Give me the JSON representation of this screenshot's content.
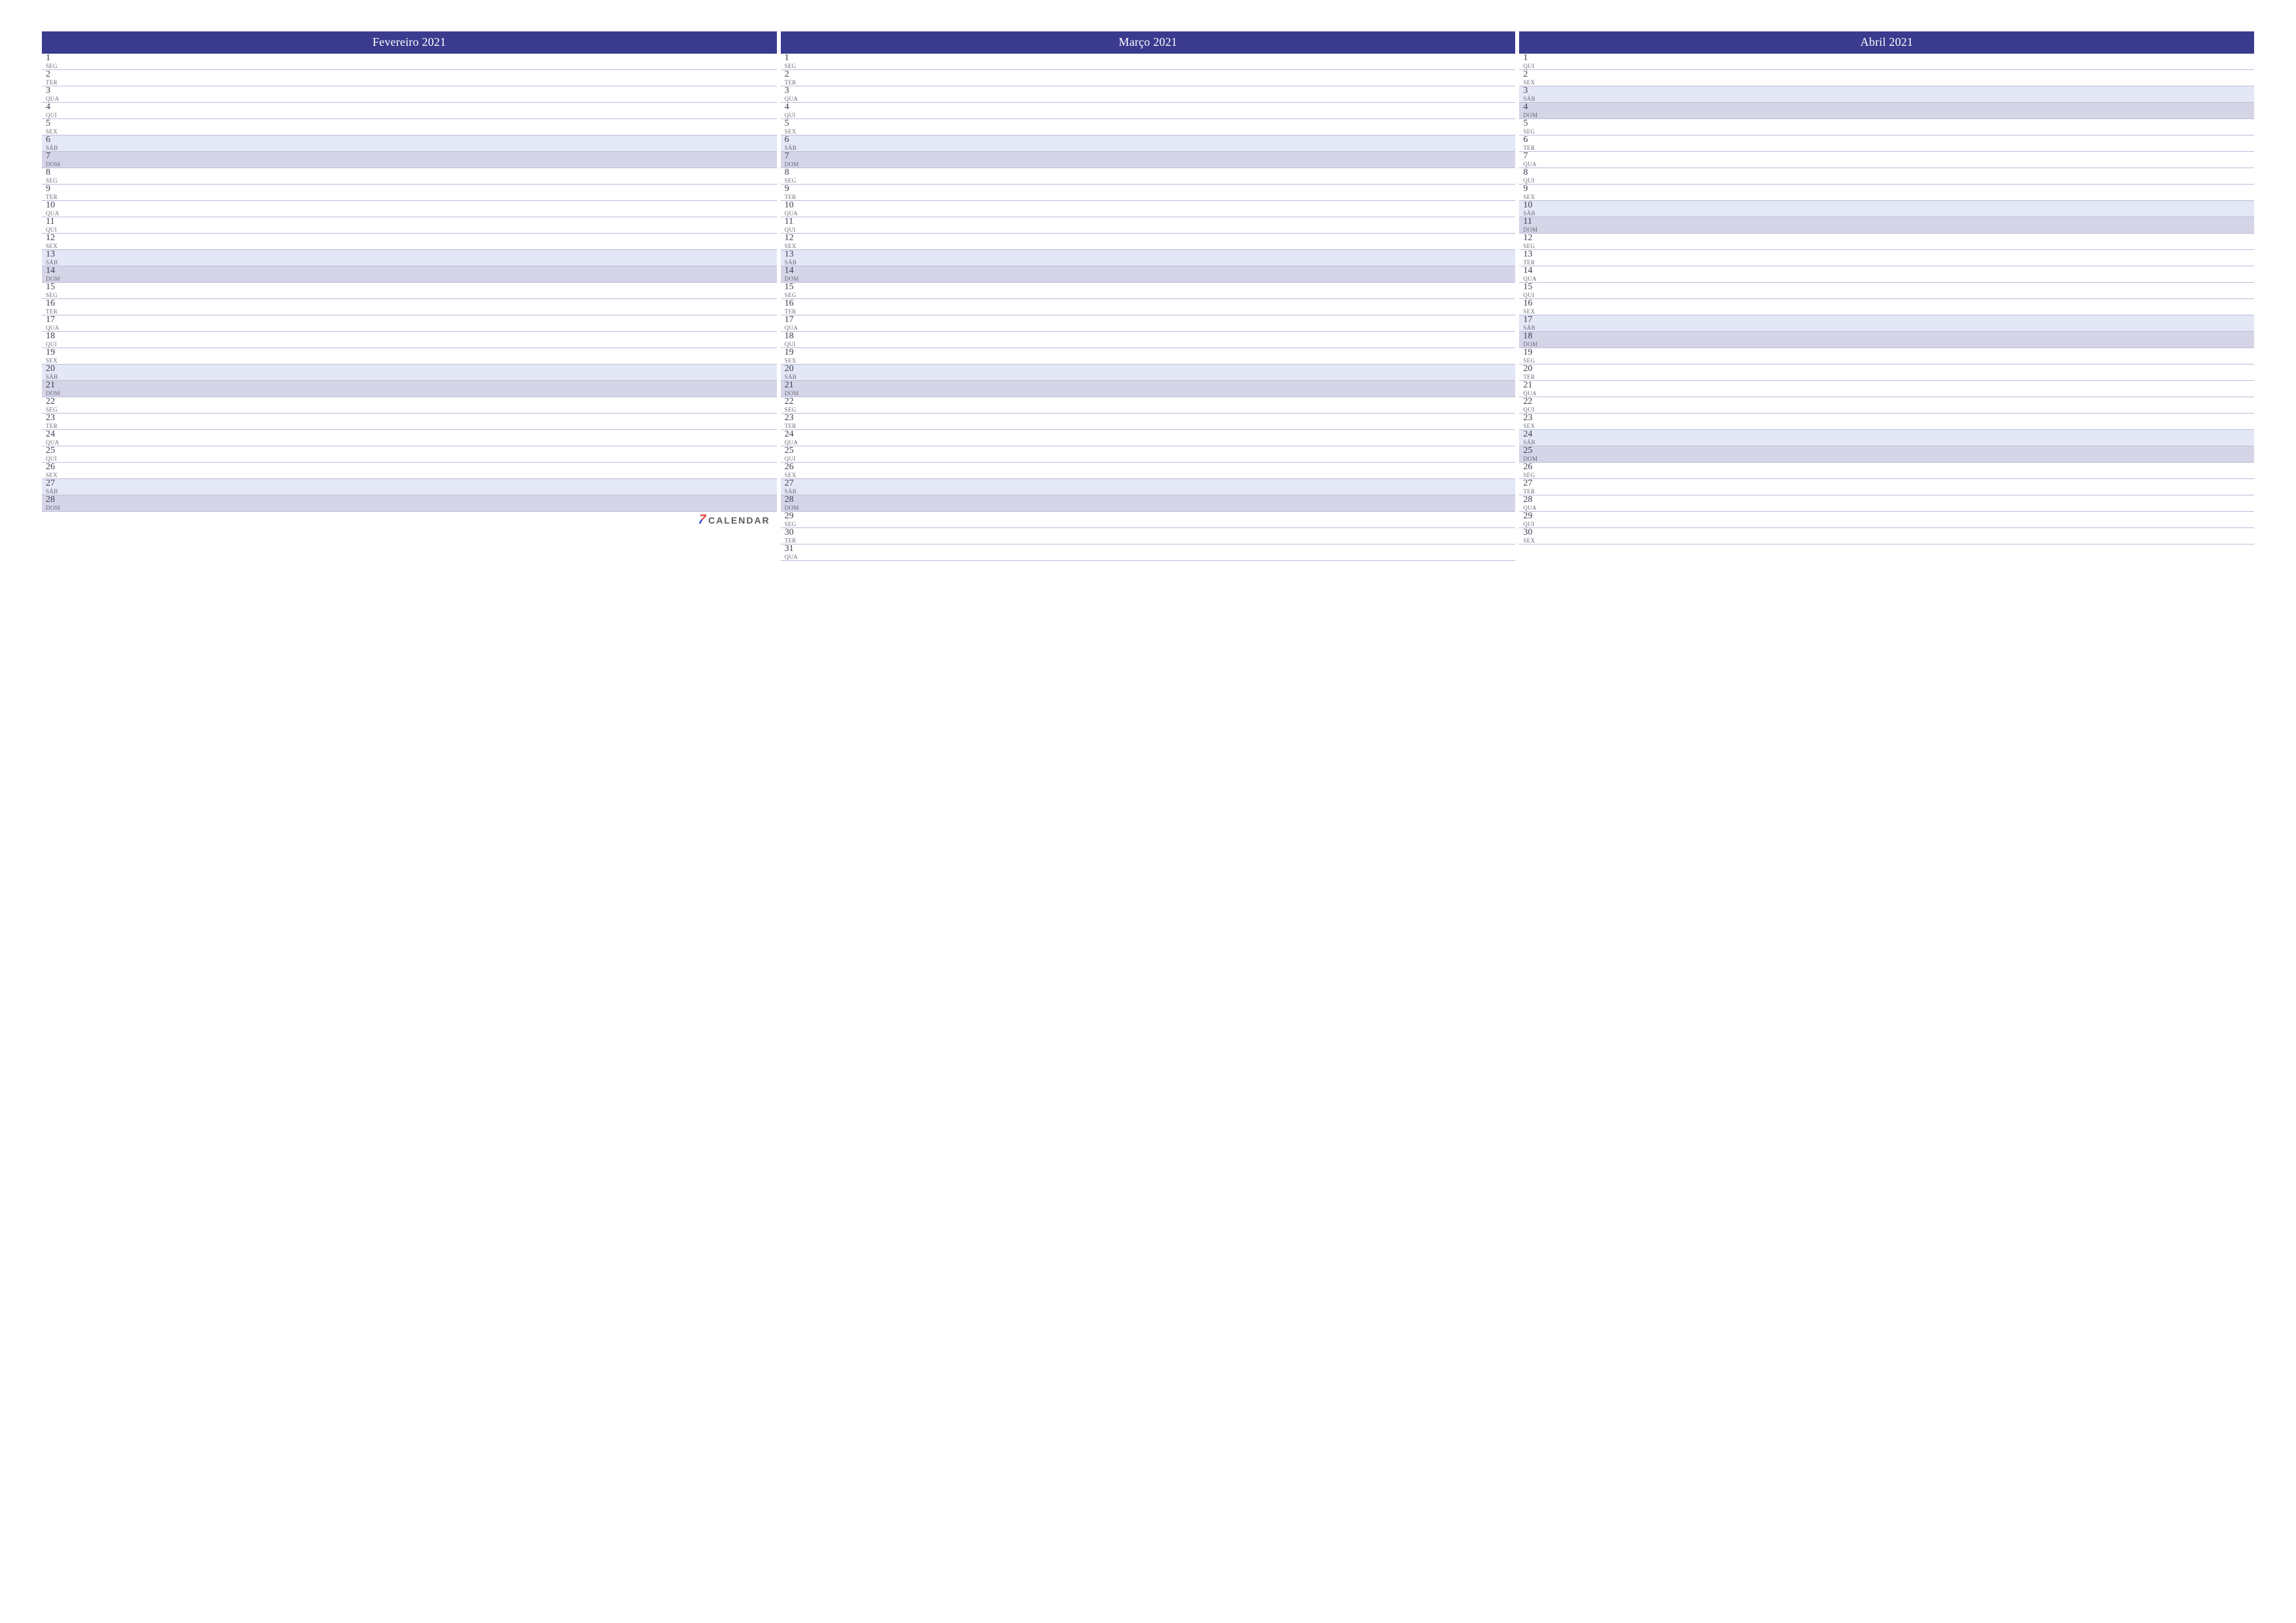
{
  "brand": {
    "seven": "7",
    "word": "CALENDAR"
  },
  "dow_names": {
    "mon": "SEG",
    "tue": "TER",
    "wed": "QUA",
    "thu": "QUI",
    "fri": "SEX",
    "sat": "SÁB",
    "sun": "DOM"
  },
  "months": [
    {
      "title": "Fevereiro 2021",
      "days": [
        {
          "n": 1,
          "dow": "mon"
        },
        {
          "n": 2,
          "dow": "tue"
        },
        {
          "n": 3,
          "dow": "wed"
        },
        {
          "n": 4,
          "dow": "thu"
        },
        {
          "n": 5,
          "dow": "fri"
        },
        {
          "n": 6,
          "dow": "sat"
        },
        {
          "n": 7,
          "dow": "sun"
        },
        {
          "n": 8,
          "dow": "mon"
        },
        {
          "n": 9,
          "dow": "tue"
        },
        {
          "n": 10,
          "dow": "wed"
        },
        {
          "n": 11,
          "dow": "thu"
        },
        {
          "n": 12,
          "dow": "fri"
        },
        {
          "n": 13,
          "dow": "sat"
        },
        {
          "n": 14,
          "dow": "sun"
        },
        {
          "n": 15,
          "dow": "mon"
        },
        {
          "n": 16,
          "dow": "tue"
        },
        {
          "n": 17,
          "dow": "wed"
        },
        {
          "n": 18,
          "dow": "thu"
        },
        {
          "n": 19,
          "dow": "fri"
        },
        {
          "n": 20,
          "dow": "sat"
        },
        {
          "n": 21,
          "dow": "sun"
        },
        {
          "n": 22,
          "dow": "mon"
        },
        {
          "n": 23,
          "dow": "tue"
        },
        {
          "n": 24,
          "dow": "wed"
        },
        {
          "n": 25,
          "dow": "thu"
        },
        {
          "n": 26,
          "dow": "fri"
        },
        {
          "n": 27,
          "dow": "sat"
        },
        {
          "n": 28,
          "dow": "sun"
        }
      ],
      "footer_brand": true
    },
    {
      "title": "Março 2021",
      "days": [
        {
          "n": 1,
          "dow": "mon"
        },
        {
          "n": 2,
          "dow": "tue"
        },
        {
          "n": 3,
          "dow": "wed"
        },
        {
          "n": 4,
          "dow": "thu"
        },
        {
          "n": 5,
          "dow": "fri"
        },
        {
          "n": 6,
          "dow": "sat"
        },
        {
          "n": 7,
          "dow": "sun"
        },
        {
          "n": 8,
          "dow": "mon"
        },
        {
          "n": 9,
          "dow": "tue"
        },
        {
          "n": 10,
          "dow": "wed"
        },
        {
          "n": 11,
          "dow": "thu"
        },
        {
          "n": 12,
          "dow": "fri"
        },
        {
          "n": 13,
          "dow": "sat"
        },
        {
          "n": 14,
          "dow": "sun"
        },
        {
          "n": 15,
          "dow": "mon"
        },
        {
          "n": 16,
          "dow": "tue"
        },
        {
          "n": 17,
          "dow": "wed"
        },
        {
          "n": 18,
          "dow": "thu"
        },
        {
          "n": 19,
          "dow": "fri"
        },
        {
          "n": 20,
          "dow": "sat"
        },
        {
          "n": 21,
          "dow": "sun"
        },
        {
          "n": 22,
          "dow": "mon"
        },
        {
          "n": 23,
          "dow": "tue"
        },
        {
          "n": 24,
          "dow": "wed"
        },
        {
          "n": 25,
          "dow": "thu"
        },
        {
          "n": 26,
          "dow": "fri"
        },
        {
          "n": 27,
          "dow": "sat"
        },
        {
          "n": 28,
          "dow": "sun"
        },
        {
          "n": 29,
          "dow": "mon"
        },
        {
          "n": 30,
          "dow": "tue"
        },
        {
          "n": 31,
          "dow": "wed"
        }
      ],
      "footer_brand": false
    },
    {
      "title": "Abril 2021",
      "days": [
        {
          "n": 1,
          "dow": "thu"
        },
        {
          "n": 2,
          "dow": "fri"
        },
        {
          "n": 3,
          "dow": "sat"
        },
        {
          "n": 4,
          "dow": "sun"
        },
        {
          "n": 5,
          "dow": "mon"
        },
        {
          "n": 6,
          "dow": "tue"
        },
        {
          "n": 7,
          "dow": "wed"
        },
        {
          "n": 8,
          "dow": "thu"
        },
        {
          "n": 9,
          "dow": "fri"
        },
        {
          "n": 10,
          "dow": "sat"
        },
        {
          "n": 11,
          "dow": "sun"
        },
        {
          "n": 12,
          "dow": "mon"
        },
        {
          "n": 13,
          "dow": "tue"
        },
        {
          "n": 14,
          "dow": "wed"
        },
        {
          "n": 15,
          "dow": "thu"
        },
        {
          "n": 16,
          "dow": "fri"
        },
        {
          "n": 17,
          "dow": "sat"
        },
        {
          "n": 18,
          "dow": "sun"
        },
        {
          "n": 19,
          "dow": "mon"
        },
        {
          "n": 20,
          "dow": "tue"
        },
        {
          "n": 21,
          "dow": "wed"
        },
        {
          "n": 22,
          "dow": "thu"
        },
        {
          "n": 23,
          "dow": "fri"
        },
        {
          "n": 24,
          "dow": "sat"
        },
        {
          "n": 25,
          "dow": "sun"
        },
        {
          "n": 26,
          "dow": "mon"
        },
        {
          "n": 27,
          "dow": "tue"
        },
        {
          "n": 28,
          "dow": "wed"
        },
        {
          "n": 29,
          "dow": "thu"
        },
        {
          "n": 30,
          "dow": "fri"
        }
      ],
      "footer_brand": false
    }
  ]
}
